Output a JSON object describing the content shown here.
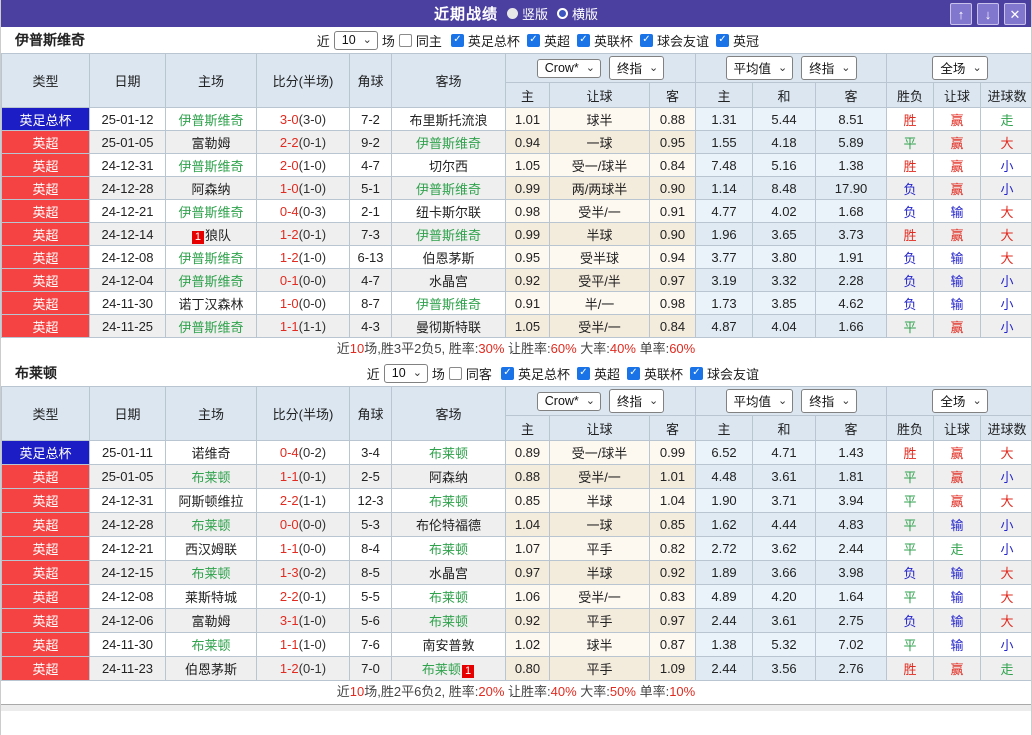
{
  "colors": {
    "accent_purple": "#4b40a0",
    "type_blue": "#1d1dc6",
    "type_red": "#f54242",
    "team_green": "#2fa24c",
    "win_red": "#e12b20",
    "lose_blue": "#2525cc",
    "header_bg": "#dbe6f1",
    "crow_bg": "#fdf8f0",
    "avg_bg": "#eaf3fa",
    "check_blue": "#1a74e8"
  },
  "titlebar": {
    "title": "近期战绩",
    "radio_vertical": "竖版",
    "radio_horizontal": "横版",
    "radio_selected": "竖版",
    "up_button": "↑",
    "down_button": "↓",
    "close_button": "✕"
  },
  "columns": {
    "type": "类型",
    "date": "日期",
    "home": "主场",
    "score": "比分(半场)",
    "corner": "角球",
    "away": "客场",
    "home_odds": "主",
    "handicap": "让球",
    "away_odds": "客",
    "avg_home": "主",
    "avg_draw": "和",
    "avg_away": "客",
    "result": "胜负",
    "handicap_result": "让球",
    "goals": "进球数"
  },
  "controls": {
    "bookmaker": "Crow*",
    "final": "终指",
    "average": "平均值",
    "final2": "终指",
    "full": "全场"
  },
  "sections": [
    {
      "team": "伊普斯维奇",
      "near_label": "近",
      "count": "10",
      "games_label": "场",
      "same_label": "同主",
      "same_checked": false,
      "leagues": [
        {
          "label": "英足总杯",
          "checked": true
        },
        {
          "label": "英超",
          "checked": true
        },
        {
          "label": "英联杯",
          "checked": true
        },
        {
          "label": "球会友谊",
          "checked": true
        },
        {
          "label": "英冠",
          "checked": true
        }
      ],
      "rows": [
        {
          "type": "英足总杯",
          "type_color": "blue",
          "date": "25-01-12",
          "home": {
            "name": "伊普斯维奇",
            "green": true
          },
          "score": "3-0",
          "half": "(3-0)",
          "corner": "7-2",
          "away": {
            "name": "布里斯托流浪",
            "green": false
          },
          "crow_home": "1.01",
          "handicap": "球半",
          "crow_away": "0.88",
          "avg_home": "1.31",
          "avg_draw": "5.44",
          "avg_away": "8.51",
          "result": {
            "t": "胜",
            "c": "r"
          },
          "handicap_result": {
            "t": "赢",
            "c": "r"
          },
          "goals": {
            "t": "走",
            "c": "g"
          }
        },
        {
          "type": "英超",
          "type_color": "red",
          "date": "25-01-05",
          "home": {
            "name": "富勒姆",
            "green": false
          },
          "score": "2-2",
          "half": "(0-1)",
          "corner": "9-2",
          "away": {
            "name": "伊普斯维奇",
            "green": true
          },
          "crow_home": "0.94",
          "handicap": "一球",
          "crow_away": "0.95",
          "avg_home": "1.55",
          "avg_draw": "4.18",
          "avg_away": "5.89",
          "result": {
            "t": "平",
            "c": "g"
          },
          "handicap_result": {
            "t": "赢",
            "c": "r"
          },
          "goals": {
            "t": "大",
            "c": "r"
          }
        },
        {
          "type": "英超",
          "type_color": "red",
          "date": "24-12-31",
          "home": {
            "name": "伊普斯维奇",
            "green": true
          },
          "score": "2-0",
          "half": "(1-0)",
          "corner": "4-7",
          "away": {
            "name": "切尔西",
            "green": false
          },
          "crow_home": "1.05",
          "handicap": "受一/球半",
          "crow_away": "0.84",
          "avg_home": "7.48",
          "avg_draw": "5.16",
          "avg_away": "1.38",
          "result": {
            "t": "胜",
            "c": "r"
          },
          "handicap_result": {
            "t": "赢",
            "c": "r"
          },
          "goals": {
            "t": "小",
            "c": "b"
          }
        },
        {
          "type": "英超",
          "type_color": "red",
          "date": "24-12-28",
          "home": {
            "name": "阿森纳",
            "green": false
          },
          "score": "1-0",
          "half": "(1-0)",
          "corner": "5-1",
          "away": {
            "name": "伊普斯维奇",
            "green": true
          },
          "crow_home": "0.99",
          "handicap": "两/两球半",
          "crow_away": "0.90",
          "avg_home": "1.14",
          "avg_draw": "8.48",
          "avg_away": "17.90",
          "result": {
            "t": "负",
            "c": "b"
          },
          "handicap_result": {
            "t": "赢",
            "c": "r"
          },
          "goals": {
            "t": "小",
            "c": "b"
          }
        },
        {
          "type": "英超",
          "type_color": "red",
          "date": "24-12-21",
          "home": {
            "name": "伊普斯维奇",
            "green": true
          },
          "score": "0-4",
          "half": "(0-3)",
          "corner": "2-1",
          "away": {
            "name": "纽卡斯尔联",
            "green": false
          },
          "crow_home": "0.98",
          "handicap": "受半/一",
          "crow_away": "0.91",
          "avg_home": "4.77",
          "avg_draw": "4.02",
          "avg_away": "1.68",
          "result": {
            "t": "负",
            "c": "b"
          },
          "handicap_result": {
            "t": "输",
            "c": "b"
          },
          "goals": {
            "t": "大",
            "c": "r"
          }
        },
        {
          "type": "英超",
          "type_color": "red",
          "date": "24-12-14",
          "home": {
            "name": "狼队",
            "green": false,
            "badge": "1",
            "badge_pos": "before"
          },
          "score": "1-2",
          "half": "(0-1)",
          "corner": "7-3",
          "away": {
            "name": "伊普斯维奇",
            "green": true
          },
          "crow_home": "0.99",
          "handicap": "半球",
          "crow_away": "0.90",
          "avg_home": "1.96",
          "avg_draw": "3.65",
          "avg_away": "3.73",
          "result": {
            "t": "胜",
            "c": "r"
          },
          "handicap_result": {
            "t": "赢",
            "c": "r"
          },
          "goals": {
            "t": "大",
            "c": "r"
          }
        },
        {
          "type": "英超",
          "type_color": "red",
          "date": "24-12-08",
          "home": {
            "name": "伊普斯维奇",
            "green": true
          },
          "score": "1-2",
          "half": "(1-0)",
          "corner": "6-13",
          "away": {
            "name": "伯恩茅斯",
            "green": false
          },
          "crow_home": "0.95",
          "handicap": "受半球",
          "crow_away": "0.94",
          "avg_home": "3.77",
          "avg_draw": "3.80",
          "avg_away": "1.91",
          "result": {
            "t": "负",
            "c": "b"
          },
          "handicap_result": {
            "t": "输",
            "c": "b"
          },
          "goals": {
            "t": "大",
            "c": "r"
          }
        },
        {
          "type": "英超",
          "type_color": "red",
          "date": "24-12-04",
          "home": {
            "name": "伊普斯维奇",
            "green": true
          },
          "score": "0-1",
          "half": "(0-0)",
          "corner": "4-7",
          "away": {
            "name": "水晶宫",
            "green": false
          },
          "crow_home": "0.92",
          "handicap": "受平/半",
          "crow_away": "0.97",
          "avg_home": "3.19",
          "avg_draw": "3.32",
          "avg_away": "2.28",
          "result": {
            "t": "负",
            "c": "b"
          },
          "handicap_result": {
            "t": "输",
            "c": "b"
          },
          "goals": {
            "t": "小",
            "c": "b"
          }
        },
        {
          "type": "英超",
          "type_color": "red",
          "date": "24-11-30",
          "home": {
            "name": "诺丁汉森林",
            "green": false
          },
          "score": "1-0",
          "half": "(0-0)",
          "corner": "8-7",
          "away": {
            "name": "伊普斯维奇",
            "green": true
          },
          "crow_home": "0.91",
          "handicap": "半/一",
          "crow_away": "0.98",
          "avg_home": "1.73",
          "avg_draw": "3.85",
          "avg_away": "4.62",
          "result": {
            "t": "负",
            "c": "b"
          },
          "handicap_result": {
            "t": "输",
            "c": "b"
          },
          "goals": {
            "t": "小",
            "c": "b"
          }
        },
        {
          "type": "英超",
          "type_color": "red",
          "date": "24-11-25",
          "home": {
            "name": "伊普斯维奇",
            "green": true
          },
          "score": "1-1",
          "half": "(1-1)",
          "corner": "4-3",
          "away": {
            "name": "曼彻斯特联",
            "green": false
          },
          "crow_home": "1.05",
          "handicap": "受半/一",
          "crow_away": "0.84",
          "avg_home": "4.87",
          "avg_draw": "4.04",
          "avg_away": "1.66",
          "result": {
            "t": "平",
            "c": "g"
          },
          "handicap_result": {
            "t": "赢",
            "c": "r"
          },
          "goals": {
            "t": "小",
            "c": "b"
          }
        }
      ],
      "summary": [
        {
          "t": "近"
        },
        {
          "t": "10",
          "red": true
        },
        {
          "t": "场,胜3平2负5, 胜率:"
        },
        {
          "t": "30%",
          "red": true
        },
        {
          "t": " 让胜率:"
        },
        {
          "t": "60%",
          "red": true
        },
        {
          "t": " 大率:"
        },
        {
          "t": "40%",
          "red": true
        },
        {
          "t": " 单率:"
        },
        {
          "t": "60%",
          "red": true
        }
      ]
    },
    {
      "team": "布莱顿",
      "near_label": "近",
      "count": "10",
      "games_label": "场",
      "same_label": "同客",
      "same_checked": false,
      "leagues": [
        {
          "label": "英足总杯",
          "checked": true
        },
        {
          "label": "英超",
          "checked": true
        },
        {
          "label": "英联杯",
          "checked": true
        },
        {
          "label": "球会友谊",
          "checked": true
        }
      ],
      "rows": [
        {
          "type": "英足总杯",
          "type_color": "blue",
          "date": "25-01-11",
          "home": {
            "name": "诺维奇",
            "green": false
          },
          "score": "0-4",
          "half": "(0-2)",
          "corner": "3-4",
          "away": {
            "name": "布莱顿",
            "green": true
          },
          "crow_home": "0.89",
          "handicap": "受一/球半",
          "crow_away": "0.99",
          "avg_home": "6.52",
          "avg_draw": "4.71",
          "avg_away": "1.43",
          "result": {
            "t": "胜",
            "c": "r"
          },
          "handicap_result": {
            "t": "赢",
            "c": "r"
          },
          "goals": {
            "t": "大",
            "c": "r"
          }
        },
        {
          "type": "英超",
          "type_color": "red",
          "date": "25-01-05",
          "home": {
            "name": "布莱顿",
            "green": true
          },
          "score": "1-1",
          "half": "(0-1)",
          "corner": "2-5",
          "away": {
            "name": "阿森纳",
            "green": false
          },
          "crow_home": "0.88",
          "handicap": "受半/一",
          "crow_away": "1.01",
          "avg_home": "4.48",
          "avg_draw": "3.61",
          "avg_away": "1.81",
          "result": {
            "t": "平",
            "c": "g"
          },
          "handicap_result": {
            "t": "赢",
            "c": "r"
          },
          "goals": {
            "t": "小",
            "c": "b"
          }
        },
        {
          "type": "英超",
          "type_color": "red",
          "date": "24-12-31",
          "home": {
            "name": "阿斯顿维拉",
            "green": false
          },
          "score": "2-2",
          "half": "(1-1)",
          "corner": "12-3",
          "away": {
            "name": "布莱顿",
            "green": true
          },
          "crow_home": "0.85",
          "handicap": "半球",
          "crow_away": "1.04",
          "avg_home": "1.90",
          "avg_draw": "3.71",
          "avg_away": "3.94",
          "result": {
            "t": "平",
            "c": "g"
          },
          "handicap_result": {
            "t": "赢",
            "c": "r"
          },
          "goals": {
            "t": "大",
            "c": "r"
          }
        },
        {
          "type": "英超",
          "type_color": "red",
          "date": "24-12-28",
          "home": {
            "name": "布莱顿",
            "green": true
          },
          "score": "0-0",
          "half": "(0-0)",
          "corner": "5-3",
          "away": {
            "name": "布伦特福德",
            "green": false
          },
          "crow_home": "1.04",
          "handicap": "一球",
          "crow_away": "0.85",
          "avg_home": "1.62",
          "avg_draw": "4.44",
          "avg_away": "4.83",
          "result": {
            "t": "平",
            "c": "g"
          },
          "handicap_result": {
            "t": "输",
            "c": "b"
          },
          "goals": {
            "t": "小",
            "c": "b"
          }
        },
        {
          "type": "英超",
          "type_color": "red",
          "date": "24-12-21",
          "home": {
            "name": "西汉姆联",
            "green": false
          },
          "score": "1-1",
          "half": "(0-0)",
          "corner": "8-4",
          "away": {
            "name": "布莱顿",
            "green": true
          },
          "crow_home": "1.07",
          "handicap": "平手",
          "crow_away": "0.82",
          "avg_home": "2.72",
          "avg_draw": "3.62",
          "avg_away": "2.44",
          "result": {
            "t": "平",
            "c": "g"
          },
          "handicap_result": {
            "t": "走",
            "c": "g"
          },
          "goals": {
            "t": "小",
            "c": "b"
          }
        },
        {
          "type": "英超",
          "type_color": "red",
          "date": "24-12-15",
          "home": {
            "name": "布莱顿",
            "green": true
          },
          "score": "1-3",
          "half": "(0-2)",
          "corner": "8-5",
          "away": {
            "name": "水晶宫",
            "green": false
          },
          "crow_home": "0.97",
          "handicap": "半球",
          "crow_away": "0.92",
          "avg_home": "1.89",
          "avg_draw": "3.66",
          "avg_away": "3.98",
          "result": {
            "t": "负",
            "c": "b"
          },
          "handicap_result": {
            "t": "输",
            "c": "b"
          },
          "goals": {
            "t": "大",
            "c": "r"
          }
        },
        {
          "type": "英超",
          "type_color": "red",
          "date": "24-12-08",
          "home": {
            "name": "莱斯特城",
            "green": false
          },
          "score": "2-2",
          "half": "(0-1)",
          "corner": "5-5",
          "away": {
            "name": "布莱顿",
            "green": true
          },
          "crow_home": "1.06",
          "handicap": "受半/一",
          "crow_away": "0.83",
          "avg_home": "4.89",
          "avg_draw": "4.20",
          "avg_away": "1.64",
          "result": {
            "t": "平",
            "c": "g"
          },
          "handicap_result": {
            "t": "输",
            "c": "b"
          },
          "goals": {
            "t": "大",
            "c": "r"
          }
        },
        {
          "type": "英超",
          "type_color": "red",
          "date": "24-12-06",
          "home": {
            "name": "富勒姆",
            "green": false
          },
          "score": "3-1",
          "half": "(1-0)",
          "corner": "5-6",
          "away": {
            "name": "布莱顿",
            "green": true
          },
          "crow_home": "0.92",
          "handicap": "平手",
          "crow_away": "0.97",
          "avg_home": "2.44",
          "avg_draw": "3.61",
          "avg_away": "2.75",
          "result": {
            "t": "负",
            "c": "b"
          },
          "handicap_result": {
            "t": "输",
            "c": "b"
          },
          "goals": {
            "t": "大",
            "c": "r"
          }
        },
        {
          "type": "英超",
          "type_color": "red",
          "date": "24-11-30",
          "home": {
            "name": "布莱顿",
            "green": true
          },
          "score": "1-1",
          "half": "(1-0)",
          "corner": "7-6",
          "away": {
            "name": "南安普敦",
            "green": false
          },
          "crow_home": "1.02",
          "handicap": "球半",
          "crow_away": "0.87",
          "avg_home": "1.38",
          "avg_draw": "5.32",
          "avg_away": "7.02",
          "result": {
            "t": "平",
            "c": "g"
          },
          "handicap_result": {
            "t": "输",
            "c": "b"
          },
          "goals": {
            "t": "小",
            "c": "b"
          }
        },
        {
          "type": "英超",
          "type_color": "red",
          "date": "24-11-23",
          "home": {
            "name": "伯恩茅斯",
            "green": false
          },
          "score": "1-2",
          "half": "(0-1)",
          "corner": "7-0",
          "away": {
            "name": "布莱顿",
            "green": true,
            "badge": "1",
            "badge_pos": "after"
          },
          "crow_home": "0.80",
          "handicap": "平手",
          "crow_away": "1.09",
          "avg_home": "2.44",
          "avg_draw": "3.56",
          "avg_away": "2.76",
          "result": {
            "t": "胜",
            "c": "r"
          },
          "handicap_result": {
            "t": "赢",
            "c": "r"
          },
          "goals": {
            "t": "走",
            "c": "g"
          }
        }
      ],
      "summary": [
        {
          "t": "近"
        },
        {
          "t": "10",
          "red": true
        },
        {
          "t": "场,胜2平6负2, 胜率:"
        },
        {
          "t": "20%",
          "red": true
        },
        {
          "t": " 让胜率:"
        },
        {
          "t": "40%",
          "red": true
        },
        {
          "t": " 大率:"
        },
        {
          "t": "50%",
          "red": true
        },
        {
          "t": " 单率:"
        },
        {
          "t": "10%",
          "red": true
        }
      ]
    }
  ]
}
